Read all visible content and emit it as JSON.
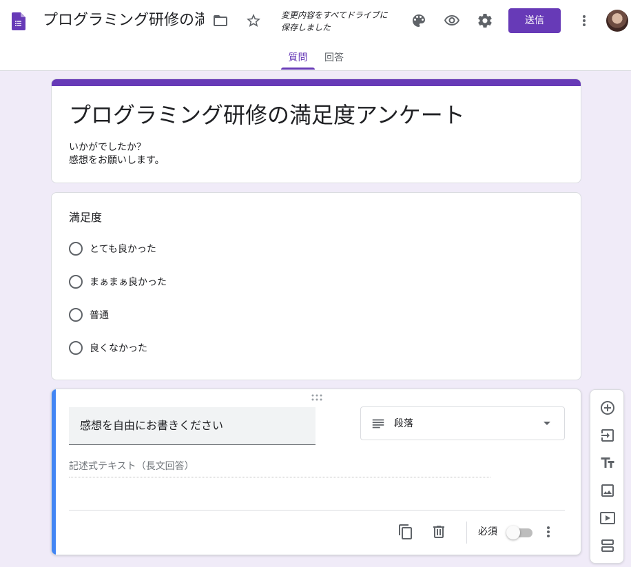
{
  "header": {
    "doc_title": "プログラミング研修の満足度アンケート",
    "save_status_line1": "変更内容をすべてドライブに",
    "save_status_line2": "保存しました",
    "send_label": "送信",
    "icons": [
      "forms-app-icon",
      "folder-icon",
      "star-icon",
      "palette-icon",
      "preview-eye-icon",
      "settings-gear-icon",
      "more-vert-icon"
    ]
  },
  "tabs": [
    {
      "label": "質問",
      "active": true
    },
    {
      "label": "回答",
      "active": false
    }
  ],
  "form": {
    "title": "プログラミング研修の満足度アンケート",
    "description_line1": "いかがでしたか？",
    "description_line2": "感想をお願いします。",
    "accent_color": "#673ab7"
  },
  "question1": {
    "title": "満足度",
    "type": "multiple-choice",
    "options": [
      "とても良かった",
      "まぁまぁ良かった",
      "普通",
      "良くなかった"
    ]
  },
  "question2": {
    "title": "感想を自由にお書きください",
    "type_label": "段落",
    "answer_placeholder": "記述式テキスト（長文回答）",
    "required_label": "必須",
    "required": false,
    "active_color": "#4285f4"
  },
  "side_toolbar": {
    "icons": [
      "add-question-icon",
      "import-questions-icon",
      "add-title-icon",
      "add-image-icon",
      "add-video-icon",
      "add-section-icon"
    ]
  }
}
